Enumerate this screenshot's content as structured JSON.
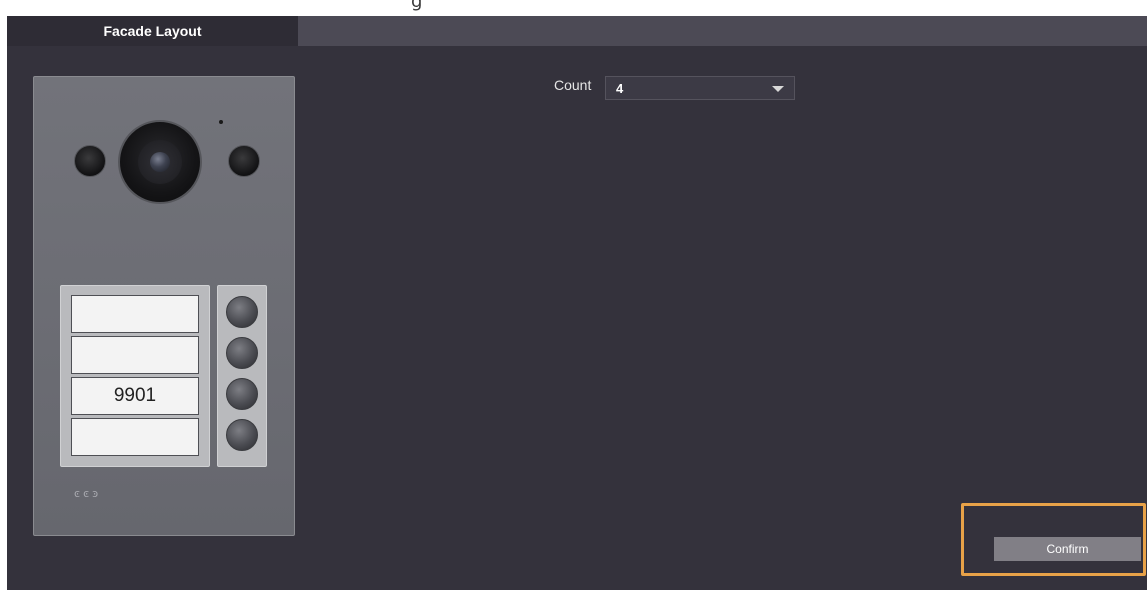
{
  "tabs": [
    {
      "label": "Facade Layout",
      "active": true
    }
  ],
  "panel": {
    "name_slots": [
      "",
      "",
      "9901",
      ""
    ],
    "call_buttons": 4,
    "status_icons": [
      "call-indicator-icon",
      "call-indicator-icon",
      "unlock-indicator-icon"
    ]
  },
  "count": {
    "label": "Count",
    "value": "4"
  },
  "actions": {
    "confirm_label": "Confirm"
  },
  "colors": {
    "background": "#34323c",
    "tab_bar": "#4c4a55",
    "active_tab": "#2e2c35",
    "highlight": "#e8a248",
    "confirm_button": "#817f86"
  }
}
